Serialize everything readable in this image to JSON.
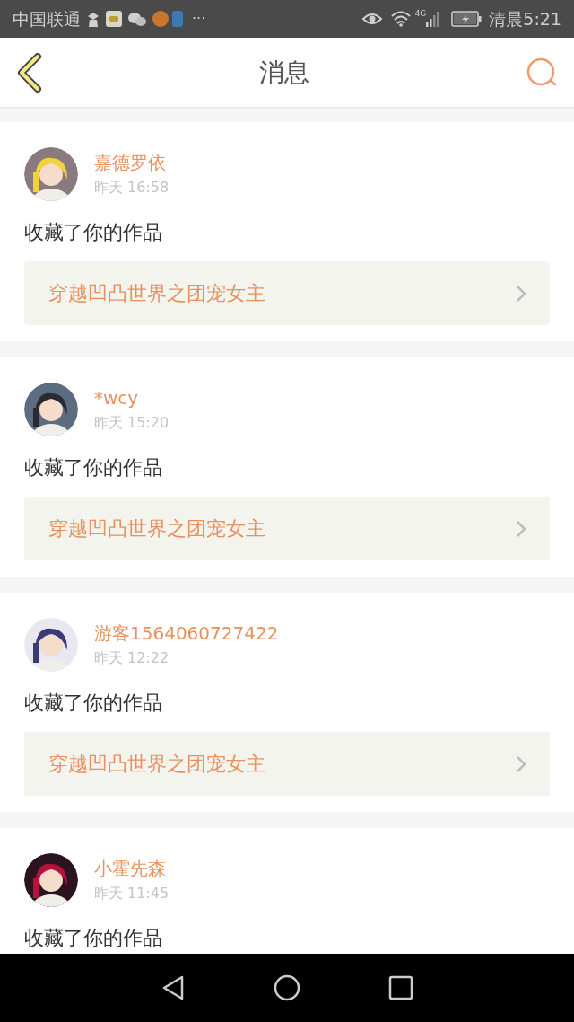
{
  "status_bar": {
    "carrier": "中国联通",
    "more": "···",
    "network": "4G",
    "time": "清晨5:21"
  },
  "header": {
    "title": "消息"
  },
  "messages": [
    {
      "user": "嘉德罗依",
      "time": "昨天 16:58",
      "action": "收藏了你的作品",
      "work": "穿越凹凸世界之团宠女主"
    },
    {
      "user": "*wcy",
      "time": "昨天 15:20",
      "action": "收藏了你的作品",
      "work": "穿越凹凸世界之团宠女主"
    },
    {
      "user": "游客1564060727422",
      "time": "昨天 12:22",
      "action": "收藏了你的作品",
      "work": "穿越凹凸世界之团宠女主"
    },
    {
      "user": "小霍先森",
      "time": "昨天 11:45",
      "action": "收藏了你的作品"
    }
  ]
}
